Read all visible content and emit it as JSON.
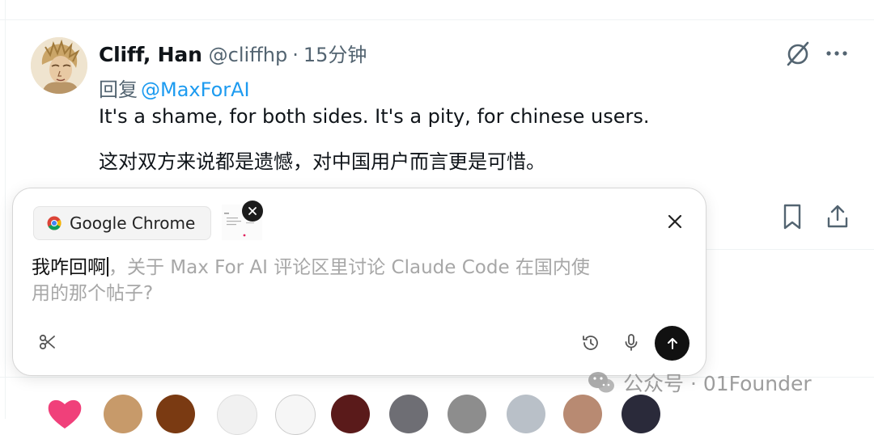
{
  "tweet": {
    "author_name": "Cliff, Han",
    "author_handle": "@cliffhp",
    "separator": "·",
    "time": "15分钟",
    "reply_prefix": "回复",
    "reply_mention": "@MaxForAI",
    "text_en": "It's a shame, for both sides. It's a pity, for chinese users.",
    "text_zh": "这对双方来说都是遗憾，对中国用户而言更是可惜。"
  },
  "composer": {
    "app_chip_label": "Google Chrome",
    "typed_text": "我咋回啊",
    "placeholder_line1": "，关于 Max For AI 评论区里讨论 Claude Code 在国内使",
    "placeholder_line2": "用的那个帖子?"
  },
  "watermark": {
    "text": "公众号 · 01Founder"
  },
  "colors": {
    "accent_link": "#1d9bf0",
    "secondary_text": "#536471",
    "send_button": "#111111"
  },
  "icons": [
    "grok-icon",
    "more-icon",
    "bookmark-icon",
    "share-icon",
    "chrome-icon",
    "close-icon",
    "scissors-icon",
    "history-icon",
    "mic-icon",
    "arrow-up-icon",
    "wechat-icon"
  ]
}
